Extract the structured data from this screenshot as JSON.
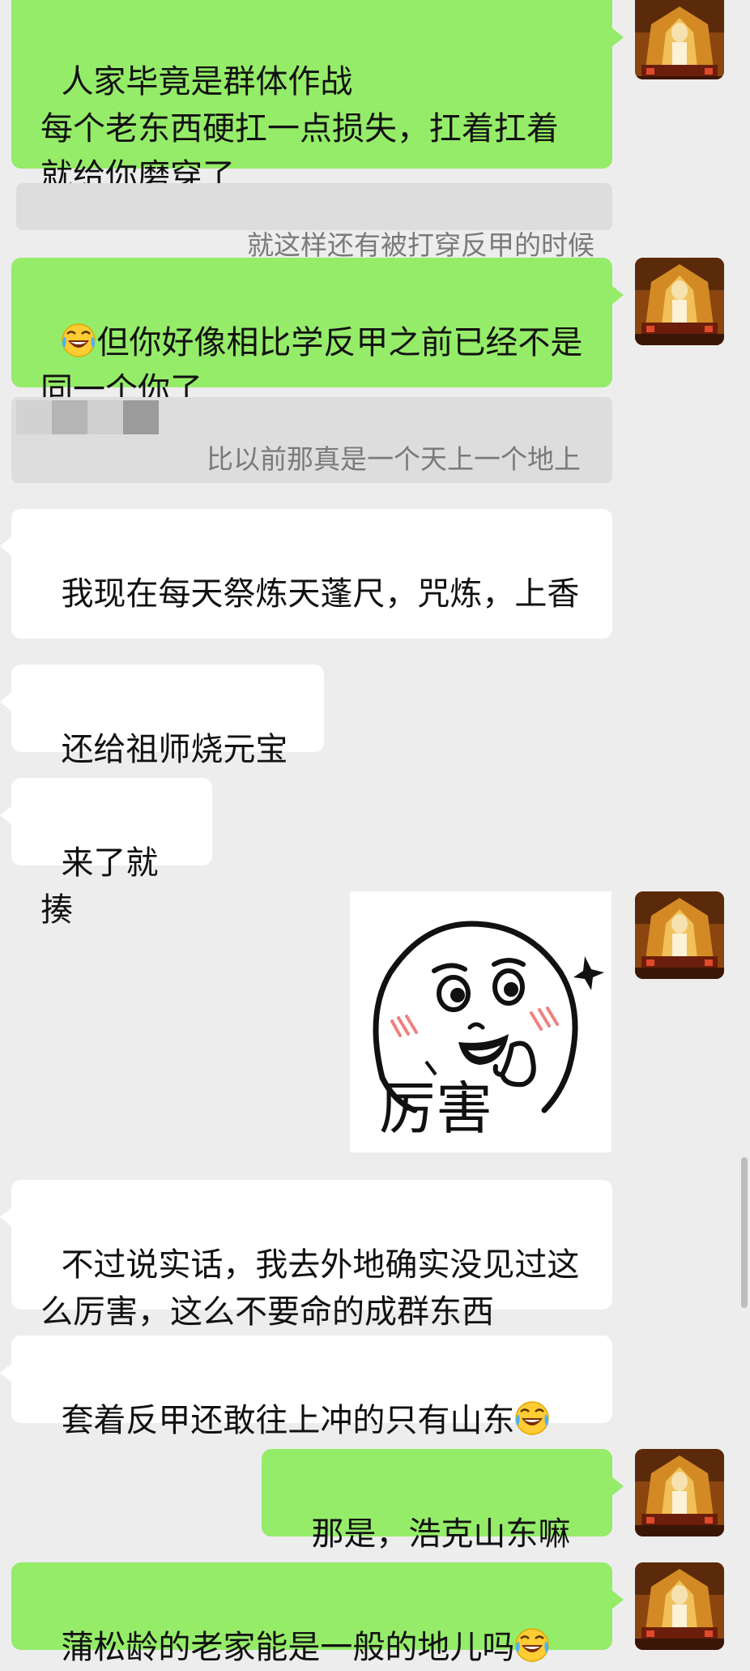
{
  "chat": {
    "messages": [
      {
        "id": "m1",
        "side": "me",
        "text": "人家毕竟是群体作战\n每个老东西硬扛一点损失，扛着扛着就给你磨穿了"
      },
      {
        "id": "q1",
        "kind": "quote",
        "text": "就这样还有被打穿反甲的时候"
      },
      {
        "id": "m2",
        "side": "me",
        "text": "但你好像相比学反甲之前已经不是同一个你了",
        "emoji_prefix": "laughing-crying-emoji"
      },
      {
        "id": "q2",
        "kind": "quote",
        "text": "比以前那真是一个天上一个地上",
        "redacted_name": true
      },
      {
        "id": "m3",
        "side": "them",
        "text": "我现在每天祭炼天蓬尺，咒炼，上香"
      },
      {
        "id": "m4",
        "side": "them",
        "text": "还给祖师烧元宝"
      },
      {
        "id": "m5",
        "side": "them",
        "text": "来了就揍"
      },
      {
        "id": "m6",
        "side": "me",
        "kind": "sticker",
        "caption": "厉害",
        "sticker_icon": "thumbs-up-face-sticker"
      },
      {
        "id": "m7",
        "side": "them",
        "text": "不过说实话，我去外地确实没见过这么厉害，这么不要命的成群东西"
      },
      {
        "id": "m8",
        "side": "them",
        "text": "套着反甲还敢往上冲的只有山东",
        "emoji_suffix": "laughing-crying-emoji"
      },
      {
        "id": "m9",
        "side": "me",
        "text": "那是，浩克山东嘛"
      },
      {
        "id": "m10",
        "side": "me",
        "text": "蒲松龄的老家能是一般的地儿吗",
        "emoji_suffix": "laughing-crying-emoji"
      }
    ]
  },
  "colors": {
    "my_bubble": "#95ec69",
    "their_bubble": "#ffffff",
    "background": "#ededed",
    "quote_bg": "#dddddd",
    "quote_text": "#7a7a7a"
  }
}
